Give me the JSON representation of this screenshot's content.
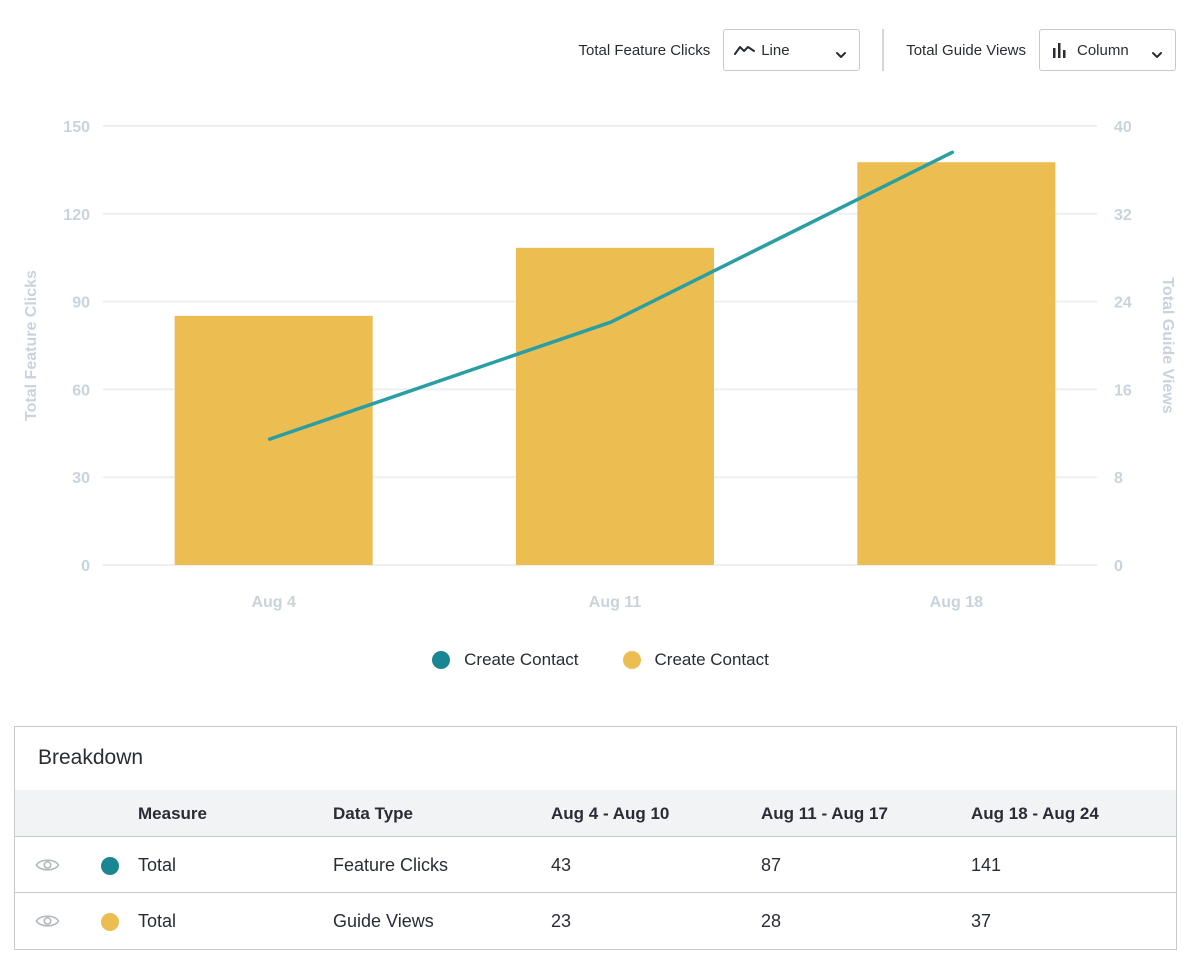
{
  "controls": {
    "feature_label": "Total Feature Clicks",
    "feature_type": "Line",
    "guide_label": "Total Guide Views",
    "guide_type": "Column"
  },
  "colors": {
    "line": "#2a9fa3",
    "bar": "#ecbd50",
    "dot_teal": "#1a8593",
    "grid": "#eeeff0",
    "axis_text": "#c9d3dc"
  },
  "chart_data": {
    "type": "bar",
    "categories": [
      "Aug 4",
      "Aug 11",
      "Aug 18"
    ],
    "series": [
      {
        "name": "Create Contact",
        "type": "line",
        "axis": "left",
        "values": [
          43,
          83,
          141
        ]
      },
      {
        "name": "Create Contact",
        "type": "bar",
        "axis": "right",
        "values": [
          22.7,
          28.9,
          36.7
        ]
      }
    ],
    "y_left": {
      "label": "Total Feature Clicks",
      "min": 0,
      "max": 150,
      "ticks": [
        0,
        30,
        60,
        90,
        120,
        150
      ]
    },
    "y_right": {
      "label": "Total Guide Views",
      "min": 0,
      "max": 40,
      "ticks": [
        0,
        8,
        16,
        24,
        32,
        40
      ]
    },
    "grid": true,
    "legend_position": "bottom-center"
  },
  "legend": [
    {
      "label": "Create Contact"
    },
    {
      "label": "Create Contact"
    }
  ],
  "breakdown": {
    "title": "Breakdown",
    "headers": [
      "Measure",
      "Data Type",
      "Aug 4 - Aug 10",
      "Aug 11 - Aug 17",
      "Aug 18 - Aug 24"
    ],
    "rows": [
      {
        "measure": "Total",
        "data_type": "Feature Clicks",
        "values": [
          "43",
          "87",
          "141"
        ]
      },
      {
        "measure": "Total",
        "data_type": "Guide Views",
        "values": [
          "23",
          "28",
          "37"
        ]
      }
    ]
  }
}
